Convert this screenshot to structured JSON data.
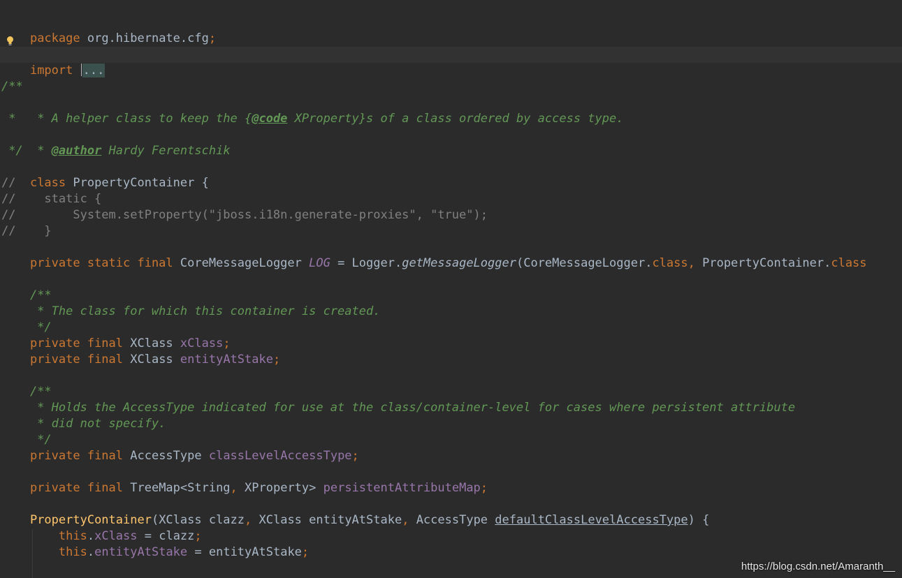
{
  "editor": {
    "lines": {
      "l1": {
        "kw": "package",
        "rest": " org.hibernate.cfg",
        "semi": ";"
      },
      "l2": {
        "kw": "import",
        "folded": "..."
      },
      "l3": "/**",
      "l4": {
        "a": " * A helper class to keep the {",
        "tag": "@code",
        "b": " XProperty}s of a class ordered by access type."
      },
      "l5": " *",
      "l6": {
        "a": " * ",
        "tag": "@author",
        "b": " Hardy Ferentschik"
      },
      "l7": " */",
      "l8": {
        "kw": "class",
        "rest": " PropertyContainer {"
      },
      "l9": "//",
      "l10": "//    static {",
      "l11": "//        System.setProperty(\"jboss.i18n.generate-proxies\", \"true\");",
      "l12": "//    }",
      "l13": {
        "kw1": "private static final",
        "type": " CoreMessageLogger ",
        "field": "LOG",
        "eq": " = Logger.",
        "method": "getMessageLogger",
        "args1": "(CoreMessageLogger.",
        "kw2": "class",
        "comma": ",",
        "args2": " PropertyContainer.",
        "kw3": "class"
      },
      "l14": "    /**",
      "l15": "     * The class for which this container is created.",
      "l16": "     */",
      "l17": {
        "kw": "private final",
        "type": " XClass ",
        "field": "xClass",
        "semi": ";"
      },
      "l18": {
        "kw": "private final",
        "type": " XClass ",
        "field": "entityAtStake",
        "semi": ";"
      },
      "l19": "    /**",
      "l20": "     * Holds the AccessType indicated for use at the class/container-level for cases where persistent attribute",
      "l21": "     * did not specify.",
      "l22": "     */",
      "l23": {
        "kw": "private final",
        "type": " AccessType ",
        "field": "classLevelAccessType",
        "semi": ";"
      },
      "l24": {
        "kw": "private final",
        "type": " TreeMap<String",
        "comma": ",",
        "type2": " XProperty> ",
        "field": "persistentAttributeMap",
        "semi": ";"
      },
      "l25": {
        "fn": "PropertyContainer",
        "p1": "(XClass clazz",
        "c1": ",",
        "p2": " XClass entityAtStake",
        "c2": ",",
        "p3": " AccessType ",
        "param": "defaultClassLevelAccessType",
        "end": ") {"
      },
      "l26": {
        "kw": "this",
        "dot": ".",
        "field": "xClass",
        "rest": " = clazz",
        "semi": ";"
      },
      "l27": {
        "kw": "this",
        "dot": ".",
        "field": "entityAtStake",
        "rest": " = entityAtStake",
        "semi": ";"
      }
    },
    "watermark": "https://blog.csdn.net/Amaranth__",
    "colors": {
      "background": "#2b2b2b",
      "keyword": "#cc7832",
      "comment": "#808080",
      "doc": "#629755",
      "field": "#9876aa",
      "function": "#ffc66d",
      "text": "#a9b7c6"
    }
  }
}
